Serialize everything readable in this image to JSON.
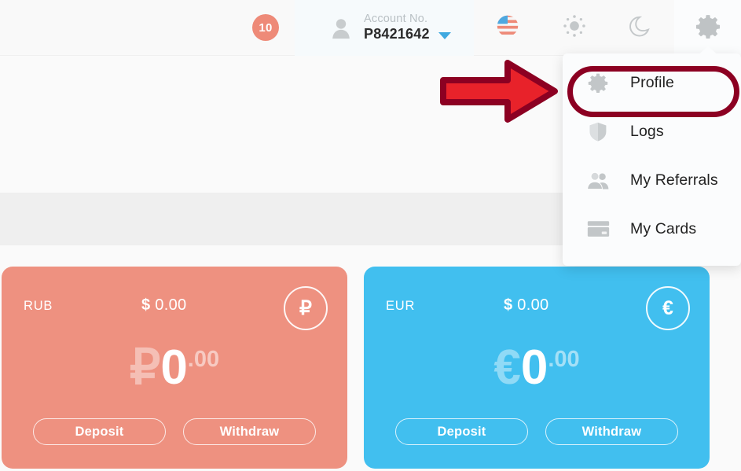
{
  "topbar": {
    "notification_badge": "10",
    "account_label": "Account No.",
    "account_number": "P8421642",
    "person_icon": "person-icon",
    "caret_icon": "chevron-down-icon",
    "icons": [
      {
        "name": "flag-us-icon",
        "title": "Language"
      },
      {
        "name": "brightness-sun-icon",
        "title": "Theme light"
      },
      {
        "name": "moon-icon",
        "title": "Theme dark"
      },
      {
        "name": "gear-icon",
        "title": "Settings"
      }
    ]
  },
  "dropdown": {
    "items": [
      {
        "label": "Profile",
        "icon": "gear-icon",
        "highlighted": true
      },
      {
        "label": "Logs",
        "icon": "shield-icon",
        "highlighted": false
      },
      {
        "label": "My Referrals",
        "icon": "people-icon",
        "highlighted": false
      },
      {
        "label": "My Cards",
        "icon": "credit-card-icon",
        "highlighted": false
      }
    ]
  },
  "annotation": {
    "arrow_fill": "#e8222a",
    "arrow_stroke": "#8c0022",
    "highlight_color": "#8c0022",
    "points_to": "Profile"
  },
  "cards": [
    {
      "code": "RUB",
      "usd_symbol": "$",
      "usd_value": "0.00",
      "badge_symbol": "₽",
      "amount_symbol": "₽",
      "amount_int": "0",
      "amount_dec": ".00",
      "deposit_label": "Deposit",
      "withdraw_label": "Withdraw",
      "color": "#ee9180"
    },
    {
      "code": "EUR",
      "usd_symbol": "$",
      "usd_value": "0.00",
      "badge_symbol": "€",
      "amount_symbol": "€",
      "amount_int": "0",
      "amount_dec": ".00",
      "deposit_label": "Deposit",
      "withdraw_label": "Withdraw",
      "color": "#41bfef"
    }
  ]
}
